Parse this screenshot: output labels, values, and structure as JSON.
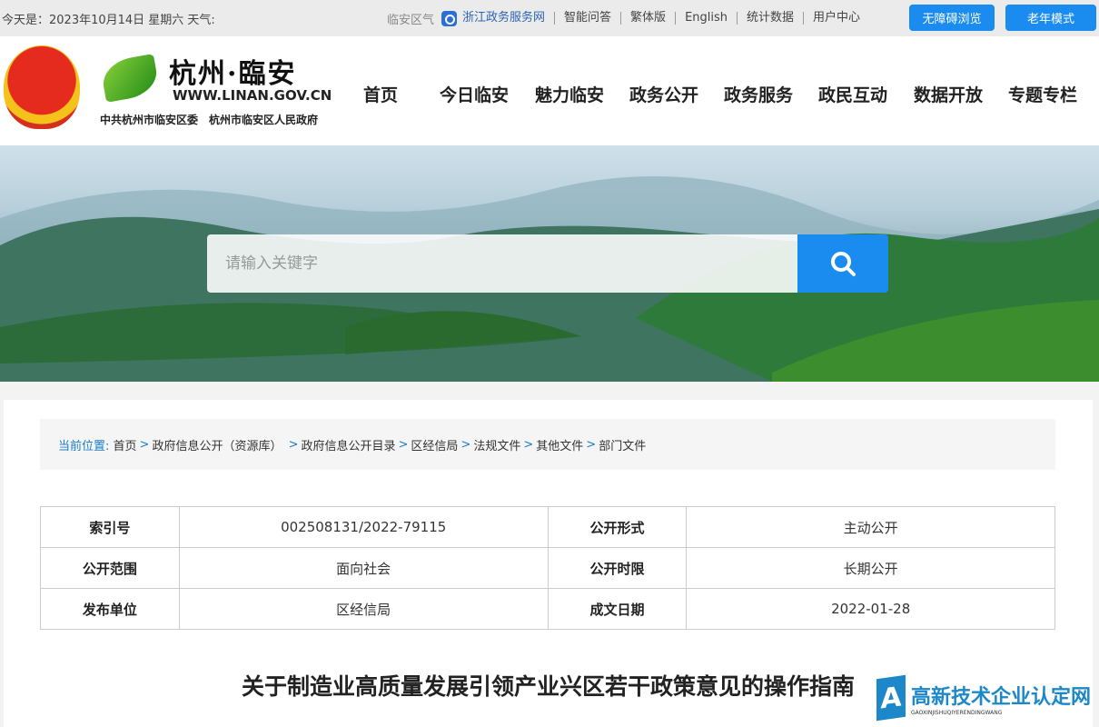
{
  "topbar": {
    "date": "今天是：2023年10月14日 星期六 天气:",
    "weather": "临安区气",
    "links": [
      "浙江政务服务网",
      "智能问答",
      "繁体版",
      "English",
      "统计数据",
      "用户中心"
    ],
    "accessible_button": "无障碍浏览",
    "elder_button": "老年模式"
  },
  "header": {
    "logo_title": "杭州·臨安",
    "logo_url": "WWW.LINAN.GOV.CN",
    "logo_sub": "中共杭州市临安区委　杭州市临安区人民政府",
    "nav": [
      "首页",
      "今日临安",
      "魅力临安",
      "政务公开",
      "政务服务",
      "政民互动",
      "数据开放",
      "专题专栏"
    ]
  },
  "search": {
    "placeholder": "请输入关键字"
  },
  "breadcrumb": {
    "label": "当前位置:",
    "items": [
      "首页",
      "政府信息公开（资源库）",
      "政府信息公开目录",
      "区经信局",
      "法规文件",
      "其他文件",
      "部门文件"
    ]
  },
  "info_table": [
    [
      "索引号",
      "002508131/2022-79115",
      "公开形式",
      "主动公开"
    ],
    [
      "公开范围",
      "面向社会",
      "公开时限",
      "长期公开"
    ],
    [
      "发布单位",
      "区经信局",
      "成文日期",
      "2022-01-28"
    ]
  ],
  "doc_title": "关于制造业高质量发展引领产业兴区若干政策意见的操作指南",
  "watermark": {
    "letter": "A",
    "text": "高新技术企业认定网",
    "sub": "GAOXINJISHUQIYERENDINGWANG"
  },
  "colors": {
    "accent": "#1a8cf0",
    "breadcrumb": "#1a7dc8"
  }
}
